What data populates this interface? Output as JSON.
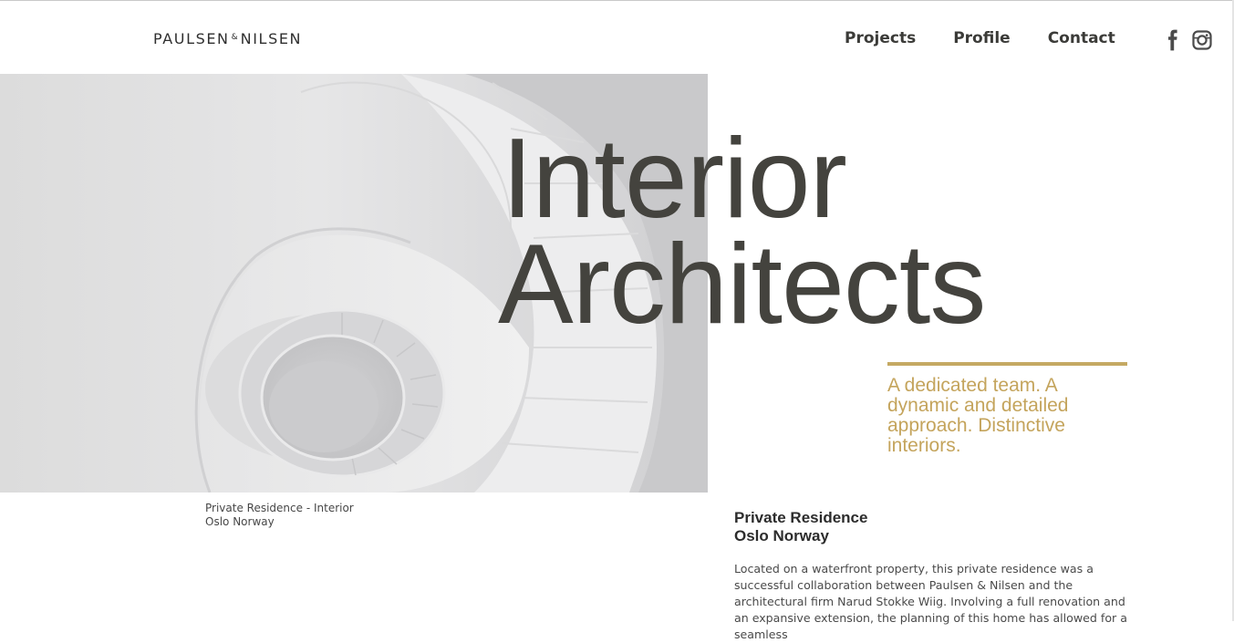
{
  "header": {
    "logo_left": "PAULSEN",
    "logo_amp": "&",
    "logo_right": "NILSEN",
    "nav": {
      "projects": "Projects",
      "profile": "Profile",
      "contact": "Contact"
    },
    "social_icons": [
      "facebook-icon",
      "instagram-icon"
    ]
  },
  "hero": {
    "image": "spiral-staircase-photo",
    "headline_line1": "Interior",
    "headline_line2": "Architects",
    "tagline": "A dedicated team. A dynamic and detailed approach. Distinctive interiors.",
    "caption_line1": "Private Residence - Interior",
    "caption_line2": "Oslo Norway"
  },
  "project": {
    "title_line1": "Private Residence",
    "title_line2": "Oslo Norway",
    "description": "Located on a waterfront property, this private residence was a successful collaboration between Paulsen & Nilsen and the architectural firm Narud Stokke Wiig. Involving a full renovation and an expansive extension, the planning of this home has allowed for a seamless"
  },
  "colors": {
    "accent_gold": "#c5a963",
    "text_dark": "#44433e"
  }
}
